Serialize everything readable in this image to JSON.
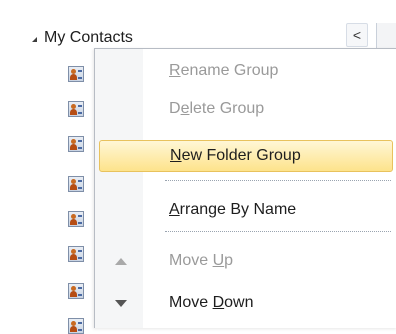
{
  "nav_pane": {
    "group_title": "My Contacts",
    "collapse_glyph": "<",
    "contacts_count_visible": 8,
    "contact_icon": "contact-card-icon"
  },
  "context_menu": {
    "items": [
      {
        "label_pre": "",
        "accel": "R",
        "label_post": "ename Group",
        "enabled": false
      },
      {
        "label_pre": "D",
        "accel": "e",
        "label_post": "lete Group",
        "enabled": false
      },
      {
        "label_pre": "",
        "accel": "N",
        "label_post": "ew Folder Group",
        "enabled": true,
        "highlighted": true
      },
      {
        "label_pre": "",
        "accel": "A",
        "label_post": "rrange By Name",
        "enabled": true
      },
      {
        "label_pre": "Move ",
        "accel": "U",
        "label_post": "p",
        "enabled": false,
        "icon": "move-up-arrow-icon"
      },
      {
        "label_pre": "Move ",
        "accel": "D",
        "label_post": "own",
        "enabled": true,
        "icon": "move-down-arrow-icon"
      }
    ],
    "highlight_color": "#fde38b",
    "disabled_text_color": "#9a9a9a"
  }
}
